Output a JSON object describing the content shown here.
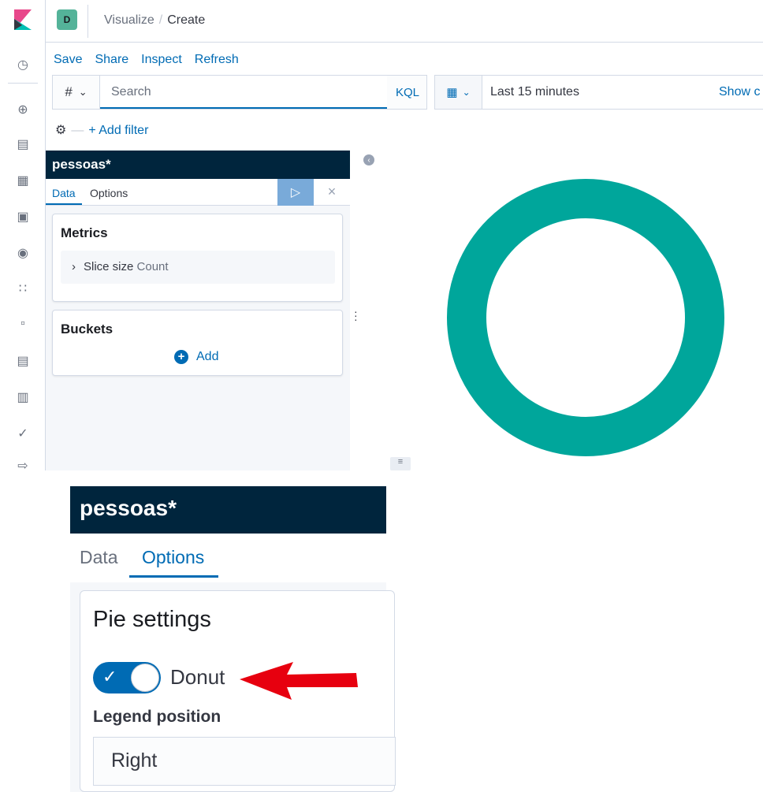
{
  "app": {
    "space_initial": "D",
    "logo": "kibana-logo"
  },
  "breadcrumb": {
    "parent": "Visualize",
    "separator": "/",
    "current": "Create"
  },
  "top_menu": [
    "Save",
    "Share",
    "Inspect",
    "Refresh"
  ],
  "query_bar": {
    "language_toggle": "#",
    "placeholder": "Search",
    "query_language": "KQL"
  },
  "time_picker": {
    "range": "Last 15 minutes",
    "show_dates": "Show c"
  },
  "filter_bar": {
    "add_filter": "+ Add filter"
  },
  "editor": {
    "index_pattern": "pessoas*",
    "tabs": [
      "Data",
      "Options"
    ],
    "active_tab": "Data",
    "metrics": {
      "title": "Metrics",
      "item_label": "Slice size",
      "item_value": "Count"
    },
    "buckets": {
      "title": "Buckets",
      "add_label": "Add"
    }
  },
  "chart_data": {
    "type": "pie",
    "donut": true,
    "slices": [
      {
        "label": "Count",
        "value": 100,
        "color": "#00a69b"
      }
    ]
  },
  "zoomed_panel": {
    "index_pattern": "pessoas*",
    "tabs": [
      "Data",
      "Options"
    ],
    "active_tab": "Options",
    "settings_title": "Pie settings",
    "donut_label": "Donut",
    "donut_enabled": true,
    "legend_position_label": "Legend position",
    "legend_position_value": "Right"
  },
  "colors": {
    "accent": "#006bb4",
    "header_dark": "#00253d",
    "donut": "#00a69b",
    "arrow": "#e7000f"
  }
}
